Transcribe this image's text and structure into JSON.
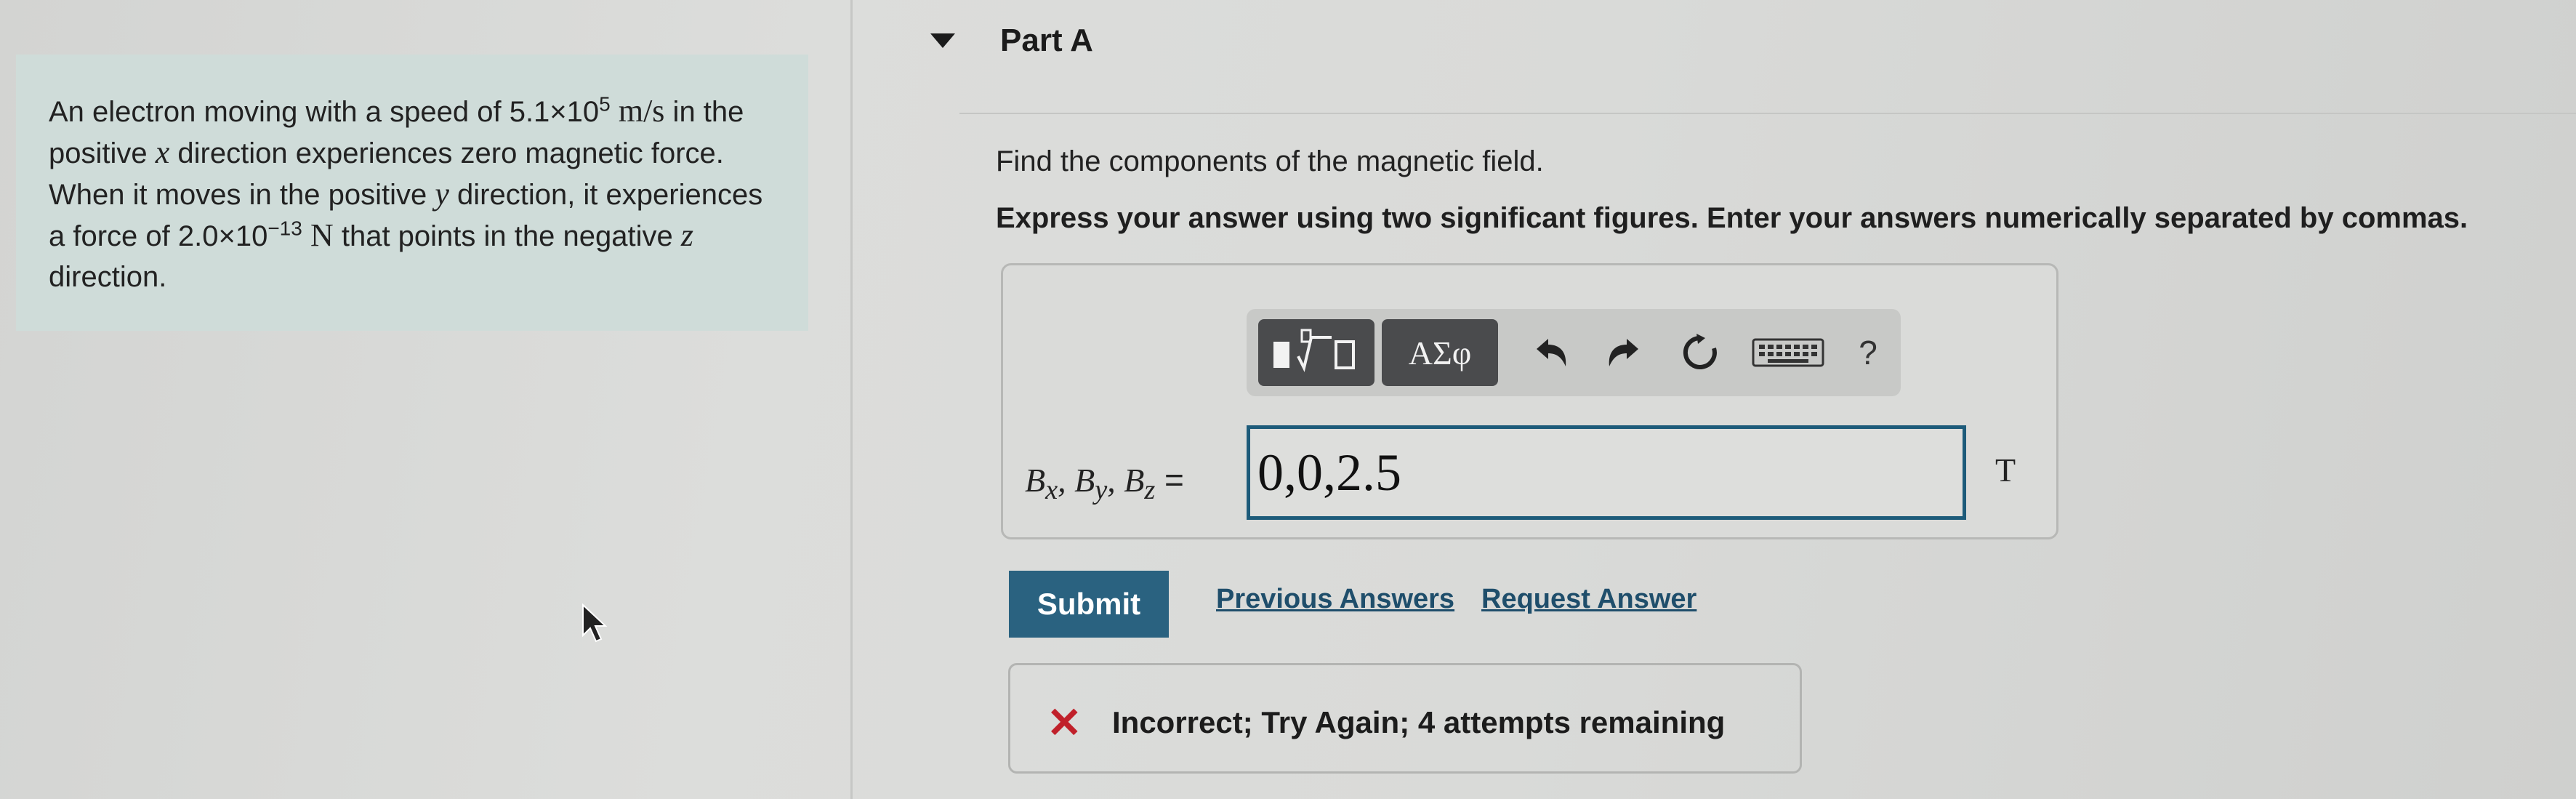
{
  "problem": {
    "segments": [
      {
        "t": "An electron moving with a speed of 5.1×10",
        "k": "text"
      },
      {
        "t": "5",
        "k": "sup"
      },
      {
        "t": " ",
        "k": "text"
      },
      {
        "t": "m/s",
        "k": "unit"
      },
      {
        "t": " in the positive ",
        "k": "text"
      },
      {
        "t": "x",
        "k": "math"
      },
      {
        "t": " direction experiences zero magnetic force. When it moves in the positive ",
        "k": "text"
      },
      {
        "t": "y",
        "k": "math"
      },
      {
        "t": " direction, it experiences a force of 2.0×10",
        "k": "text"
      },
      {
        "t": "−13",
        "k": "sup"
      },
      {
        "t": " ",
        "k": "text"
      },
      {
        "t": "N",
        "k": "unit"
      },
      {
        "t": " that points in the negative ",
        "k": "text"
      },
      {
        "t": "z",
        "k": "math"
      },
      {
        "t": " direction.",
        "k": "text"
      }
    ]
  },
  "part": {
    "title": "Part A"
  },
  "instruction": "Find the components of the magnetic field.",
  "directive": "Express your answer using two significant figures. Enter your answers numerically separated by commas.",
  "toolbar": {
    "greek_label": "ΑΣφ",
    "help_label": "?",
    "icons": [
      "templates-icon",
      "greek-icon",
      "undo-icon",
      "redo-icon",
      "reset-icon",
      "keyboard-icon",
      "help-icon"
    ]
  },
  "answer": {
    "label_parts": [
      "B",
      "x",
      ", B",
      "y",
      ", B",
      "z"
    ],
    "equals": " =",
    "value": "0,0,2.5",
    "unit": "T"
  },
  "actions": {
    "submit_label": "Submit",
    "previous_answers_label": "Previous Answers",
    "request_answer_label": "Request Answer"
  },
  "feedback": {
    "text": "Incorrect; Try Again; 4 attempts remaining",
    "status_color": "#c0202a"
  },
  "colors": {
    "accent": "#2a6280",
    "input_border": "#1d5b7a"
  }
}
